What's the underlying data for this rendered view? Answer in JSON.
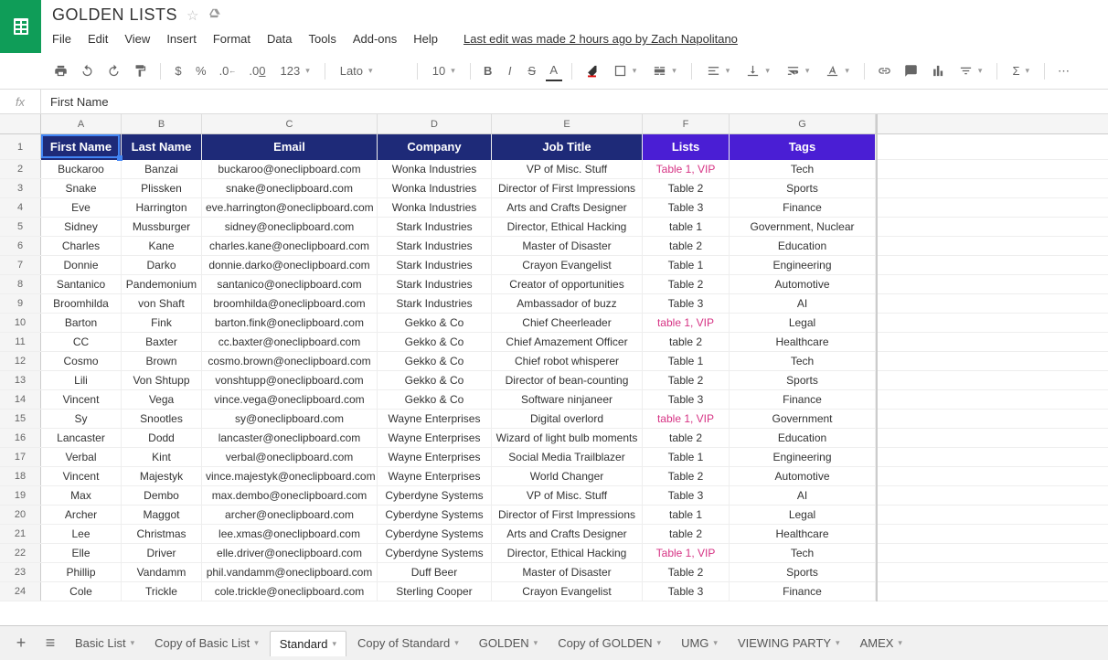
{
  "doc": {
    "title": "GOLDEN LISTS"
  },
  "menu": {
    "file": "File",
    "edit": "Edit",
    "view": "View",
    "insert": "Insert",
    "format": "Format",
    "data": "Data",
    "tools": "Tools",
    "addons": "Add-ons",
    "help": "Help",
    "last_edit": "Last edit was made 2 hours ago by Zach Napolitano"
  },
  "toolbar": {
    "currency": "$",
    "percent": "%",
    "dec_dec": ".0",
    "dec_inc": ".00",
    "num_format": "123",
    "font": "Lato",
    "font_size": "10",
    "bold": "B",
    "italic": "I",
    "strike": "S",
    "textcolor": "A"
  },
  "formula": {
    "fx": "fx",
    "value": "First Name"
  },
  "columns": [
    "A",
    "B",
    "C",
    "D",
    "E",
    "F",
    "G"
  ],
  "headers": {
    "A": "First Name",
    "B": "Last Name",
    "C": "Email",
    "D": "Company",
    "E": "Job Title",
    "F": "Lists",
    "G": "Tags"
  },
  "chart_data": {
    "type": "table",
    "columns": [
      "First Name",
      "Last Name",
      "Email",
      "Company",
      "Job Title",
      "Lists",
      "Tags"
    ],
    "rows": [
      {
        "first": "Buckaroo",
        "last": "Banzai",
        "email": "buckaroo@oneclipboard.com",
        "company": "Wonka Industries",
        "job": "VP of Misc. Stuff",
        "lists": "Table 1, VIP",
        "tags": "Tech",
        "vip": true
      },
      {
        "first": "Snake",
        "last": "Plissken",
        "email": "snake@oneclipboard.com",
        "company": "Wonka Industries",
        "job": "Director of First Impressions",
        "lists": "Table 2",
        "tags": "Sports"
      },
      {
        "first": "Eve",
        "last": "Harrington",
        "email": "eve.harrington@oneclipboard.com",
        "company": "Wonka Industries",
        "job": "Arts and Crafts Designer",
        "lists": "Table 3",
        "tags": "Finance"
      },
      {
        "first": "Sidney",
        "last": "Mussburger",
        "email": "sidney@oneclipboard.com",
        "company": "Stark Industries",
        "job": "Director, Ethical Hacking",
        "lists": "table 1",
        "tags": "Government, Nuclear"
      },
      {
        "first": "Charles",
        "last": "Kane",
        "email": "charles.kane@oneclipboard.com",
        "company": "Stark Industries",
        "job": "Master of Disaster",
        "lists": "table 2",
        "tags": "Education"
      },
      {
        "first": "Donnie",
        "last": "Darko",
        "email": "donnie.darko@oneclipboard.com",
        "company": "Stark Industries",
        "job": "Crayon Evangelist",
        "lists": "Table 1",
        "tags": "Engineering"
      },
      {
        "first": "Santanico",
        "last": "Pandemonium",
        "email": "santanico@oneclipboard.com",
        "company": "Stark Industries",
        "job": "Creator of opportunities",
        "lists": "Table 2",
        "tags": "Automotive"
      },
      {
        "first": "Broomhilda",
        "last": "von Shaft",
        "email": "broomhilda@oneclipboard.com",
        "company": "Stark Industries",
        "job": "Ambassador of buzz",
        "lists": "Table 3",
        "tags": "AI"
      },
      {
        "first": "Barton",
        "last": "Fink",
        "email": "barton.fink@oneclipboard.com",
        "company": "Gekko & Co",
        "job": "Chief Cheerleader",
        "lists": "table 1, VIP",
        "tags": "Legal",
        "vip": true
      },
      {
        "first": "CC",
        "last": "Baxter",
        "email": "cc.baxter@oneclipboard.com",
        "company": "Gekko & Co",
        "job": "Chief Amazement Officer",
        "lists": "table 2",
        "tags": "Healthcare"
      },
      {
        "first": "Cosmo",
        "last": "Brown",
        "email": "cosmo.brown@oneclipboard.com",
        "company": "Gekko & Co",
        "job": "Chief robot whisperer",
        "lists": "Table 1",
        "tags": "Tech"
      },
      {
        "first": "Lili",
        "last": "Von Shtupp",
        "email": "vonshtupp@oneclipboard.com",
        "company": "Gekko & Co",
        "job": "Director of bean-counting",
        "lists": "Table 2",
        "tags": "Sports"
      },
      {
        "first": "Vincent",
        "last": "Vega",
        "email": "vince.vega@oneclipboard.com",
        "company": "Gekko & Co",
        "job": "Software ninjaneer",
        "lists": "Table 3",
        "tags": "Finance"
      },
      {
        "first": "Sy",
        "last": "Snootles",
        "email": "sy@oneclipboard.com",
        "company": "Wayne Enterprises",
        "job": "Digital overlord",
        "lists": "table 1, VIP",
        "tags": "Government",
        "vip": true
      },
      {
        "first": "Lancaster",
        "last": "Dodd",
        "email": "lancaster@oneclipboard.com",
        "company": "Wayne Enterprises",
        "job": "Wizard of light bulb moments",
        "lists": "table 2",
        "tags": "Education"
      },
      {
        "first": "Verbal",
        "last": "Kint",
        "email": "verbal@oneclipboard.com",
        "company": "Wayne Enterprises",
        "job": "Social Media Trailblazer",
        "lists": "Table 1",
        "tags": "Engineering"
      },
      {
        "first": "Vincent",
        "last": "Majestyk",
        "email": "vince.majestyk@oneclipboard.com",
        "company": "Wayne Enterprises",
        "job": "World Changer",
        "lists": "Table 2",
        "tags": "Automotive"
      },
      {
        "first": "Max",
        "last": "Dembo",
        "email": "max.dembo@oneclipboard.com",
        "company": "Cyberdyne Systems",
        "job": "VP of Misc. Stuff",
        "lists": "Table 3",
        "tags": "AI"
      },
      {
        "first": "Archer",
        "last": "Maggot",
        "email": "archer@oneclipboard.com",
        "company": "Cyberdyne Systems",
        "job": "Director of First Impressions",
        "lists": "table 1",
        "tags": "Legal"
      },
      {
        "first": "Lee",
        "last": "Christmas",
        "email": "lee.xmas@oneclipboard.com",
        "company": "Cyberdyne Systems",
        "job": "Arts and Crafts Designer",
        "lists": "table 2",
        "tags": "Healthcare"
      },
      {
        "first": "Elle",
        "last": "Driver",
        "email": "elle.driver@oneclipboard.com",
        "company": "Cyberdyne Systems",
        "job": "Director, Ethical Hacking",
        "lists": "Table 1, VIP",
        "tags": "Tech",
        "vip": true
      },
      {
        "first": "Phillip",
        "last": "Vandamm",
        "email": "phil.vandamm@oneclipboard.com",
        "company": "Duff Beer",
        "job": "Master of Disaster",
        "lists": "Table 2",
        "tags": "Sports"
      },
      {
        "first": "Cole",
        "last": "Trickle",
        "email": "cole.trickle@oneclipboard.com",
        "company": "Sterling Cooper",
        "job": "Crayon Evangelist",
        "lists": "Table 3",
        "tags": "Finance"
      }
    ]
  },
  "sheets": {
    "tabs": [
      "Basic List",
      "Copy of Basic List",
      "Standard",
      "Copy of Standard",
      "GOLDEN",
      "Copy of GOLDEN",
      "UMG",
      "VIEWING PARTY",
      "AMEX"
    ],
    "active": "Standard"
  }
}
